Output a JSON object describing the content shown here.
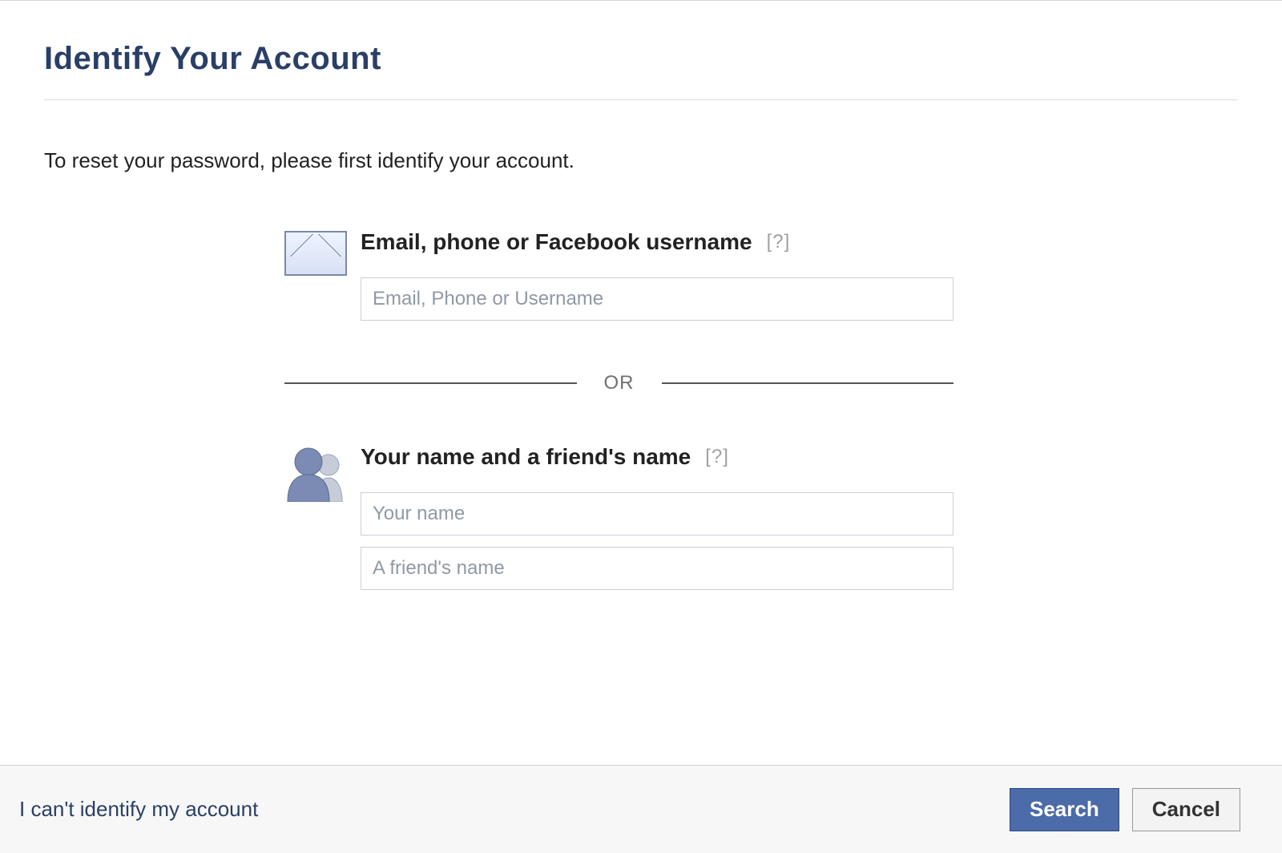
{
  "header": {
    "title": "Identify Your Account"
  },
  "instruction": "To reset your password, please first identify your account.",
  "section_email": {
    "label": "Email, phone or Facebook username",
    "help": "[?]",
    "placeholder": "Email, Phone or Username"
  },
  "divider": {
    "text": "OR"
  },
  "section_name": {
    "label": "Your name and a friend's name",
    "help": "[?]",
    "your_name_placeholder": "Your name",
    "friend_name_placeholder": "A friend's name"
  },
  "footer": {
    "cant_identify": "I can't identify my account",
    "search": "Search",
    "cancel": "Cancel"
  }
}
